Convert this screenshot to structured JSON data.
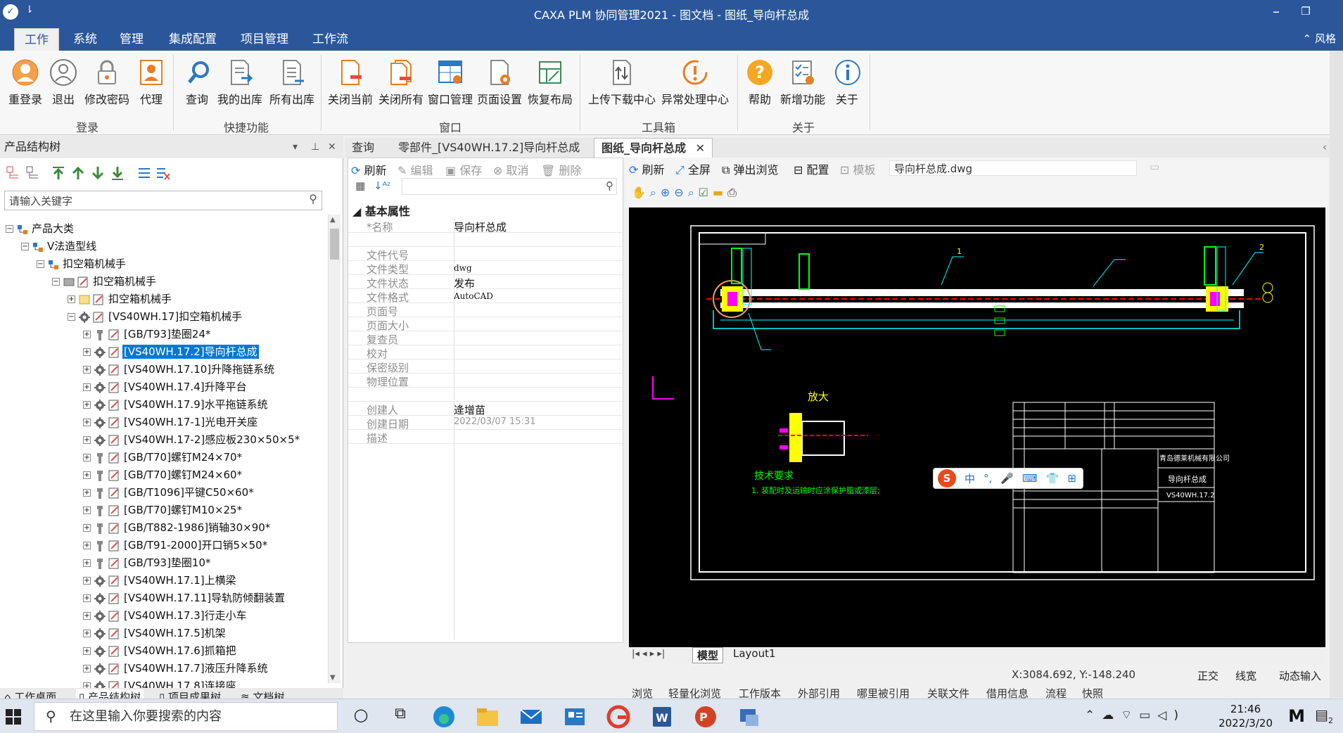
{
  "window": {
    "title": "CAXA PLM 协同管理2021 - 图文档 - 图纸_导向杆总成",
    "qa_glyph": "⇂"
  },
  "menu": {
    "tabs": [
      "工作",
      "系统",
      "管理",
      "集成配置",
      "项目管理",
      "工作流"
    ],
    "right": "⌃ 风格"
  },
  "ribbon": {
    "groups": [
      {
        "label": "登录",
        "buttons": [
          "重登录",
          "退出",
          "修改密码",
          "代理"
        ]
      },
      {
        "label": "快捷功能",
        "buttons": [
          "查询",
          "我的出库",
          "所有出库"
        ]
      },
      {
        "label": "窗口",
        "buttons": [
          "关闭当前",
          "关闭所有",
          "窗口管理",
          "页面设置",
          "恢复布局"
        ]
      },
      {
        "label": "工具箱",
        "buttons": [
          "上传下载中心",
          "异常处理中心"
        ]
      },
      {
        "label": "关于",
        "buttons": [
          "帮助",
          "新增功能",
          "关于"
        ]
      }
    ]
  },
  "left_panel": {
    "title": "产品结构树",
    "search_placeholder": "请输入关键字",
    "tree": [
      {
        "label": "产品大类",
        "level": 0
      },
      {
        "label": "V法造型线",
        "level": 1
      },
      {
        "label": "扣空箱机械手",
        "level": 2
      },
      {
        "label": "扣空箱机械手",
        "level": 3
      },
      {
        "label": "扣空箱机械手",
        "level": 4
      },
      {
        "label": "[VS40WH.17]扣空箱机械手",
        "level": 4
      },
      {
        "label": "[GB/T93]垫圈24*",
        "level": 5
      },
      {
        "label": "[VS40WH.17.2]导向杆总成",
        "level": 5,
        "selected": true
      },
      {
        "label": "[VS40WH.17.10]升降拖链系统",
        "level": 5
      },
      {
        "label": "[VS40WH.17.4]升降平台",
        "level": 5
      },
      {
        "label": "[VS40WH.17.9]水平拖链系统",
        "level": 5
      },
      {
        "label": "[VS40WH.17-1]光电开关座",
        "level": 5
      },
      {
        "label": "[VS40WH.17-2]感应板230×50×5*",
        "level": 5
      },
      {
        "label": "[GB/T70]螺钉M24×70*",
        "level": 5
      },
      {
        "label": "[GB/T70]螺钉M24×60*",
        "level": 5
      },
      {
        "label": "[GB/T1096]平键C50×60*",
        "level": 5
      },
      {
        "label": "[GB/T70]螺钉M10×25*",
        "level": 5
      },
      {
        "label": "[GB/T882-1986]销轴30×90*",
        "level": 5
      },
      {
        "label": "[GB/T91-2000]开口销5×50*",
        "level": 5
      },
      {
        "label": "[GB/T93]垫圈10*",
        "level": 5
      },
      {
        "label": "[VS40WH.17.1]上横梁",
        "level": 5
      },
      {
        "label": "[VS40WH.17.11]导轨防倾翻装置",
        "level": 5
      },
      {
        "label": "[VS40WH.17.3]行走小车",
        "level": 5
      },
      {
        "label": "[VS40WH.17.5]机架",
        "level": 5
      },
      {
        "label": "[VS40WH.17.6]抓箱把",
        "level": 5
      },
      {
        "label": "[VS40WH.17.7]液压升降系统",
        "level": 5
      },
      {
        "label": "[VS40WH.17.8]连接座",
        "level": 5
      }
    ],
    "bottom_tabs": [
      "工作桌面",
      "产品结构树",
      "项目成果树",
      "文档树"
    ]
  },
  "doc_tabs": [
    "查询",
    "零部件_[VS40WH.17.2]导向杆总成",
    "图纸_导向杆总成"
  ],
  "middle": {
    "toolbar": [
      "刷新",
      "编辑",
      "保存",
      "取消",
      "删除"
    ],
    "section": "基本属性",
    "props": [
      {
        "k": "*名称",
        "v": "导向杆总成"
      },
      {
        "k": "",
        "v": ""
      },
      {
        "k": "文件代号",
        "v": ""
      },
      {
        "k": "文件类型",
        "v": "dwg"
      },
      {
        "k": "文件状态",
        "v": "发布"
      },
      {
        "k": "文件格式",
        "v": "AutoCAD"
      },
      {
        "k": "页面号",
        "v": ""
      },
      {
        "k": "页面大小",
        "v": ""
      },
      {
        "k": "复查员",
        "v": ""
      },
      {
        "k": "校对",
        "v": ""
      },
      {
        "k": "保密级别",
        "v": ""
      },
      {
        "k": "物理位置",
        "v": ""
      },
      {
        "k": "",
        "v": ""
      },
      {
        "k": "创建人",
        "v": "逄增苗"
      },
      {
        "k": "创建日期",
        "v": "2022/03/07 15:31"
      },
      {
        "k": "描述",
        "v": ""
      }
    ]
  },
  "viewer": {
    "toolbar": [
      "刷新",
      "全屏",
      "弹出浏览",
      "配置",
      "模板"
    ],
    "filename": "导向杆总成.dwg",
    "layout_tabs": [
      "模型",
      "Layout1"
    ],
    "coords": "X:3084.692, Y:-148.240",
    "status": [
      "正交",
      "线宽",
      "动态输入"
    ],
    "bottom_tabs": [
      "浏览",
      "轻量化浏览",
      "工作版本",
      "外部引用",
      "哪里被引用",
      "关联文件",
      "借用信息",
      "流程",
      "快照"
    ],
    "drawing_text": {
      "enlarge": "放大",
      "tech_title": "技术要求",
      "tech_note": "1. 装配时及运输时应涂保护脂或漆层;",
      "company": "青岛德莱机械有限公司",
      "part_name": "导向杆总成",
      "part_code": "VS40WH.17.2",
      "balloon1": "1",
      "balloon2": "2"
    },
    "ime": [
      "中",
      "°,",
      "🎤",
      "⌨",
      "👕",
      "⊞"
    ]
  },
  "taskbar": {
    "search_placeholder": "在这里输入你要搜索的内容",
    "time": "21:46",
    "date": "2022/3/20",
    "notif": "2"
  }
}
